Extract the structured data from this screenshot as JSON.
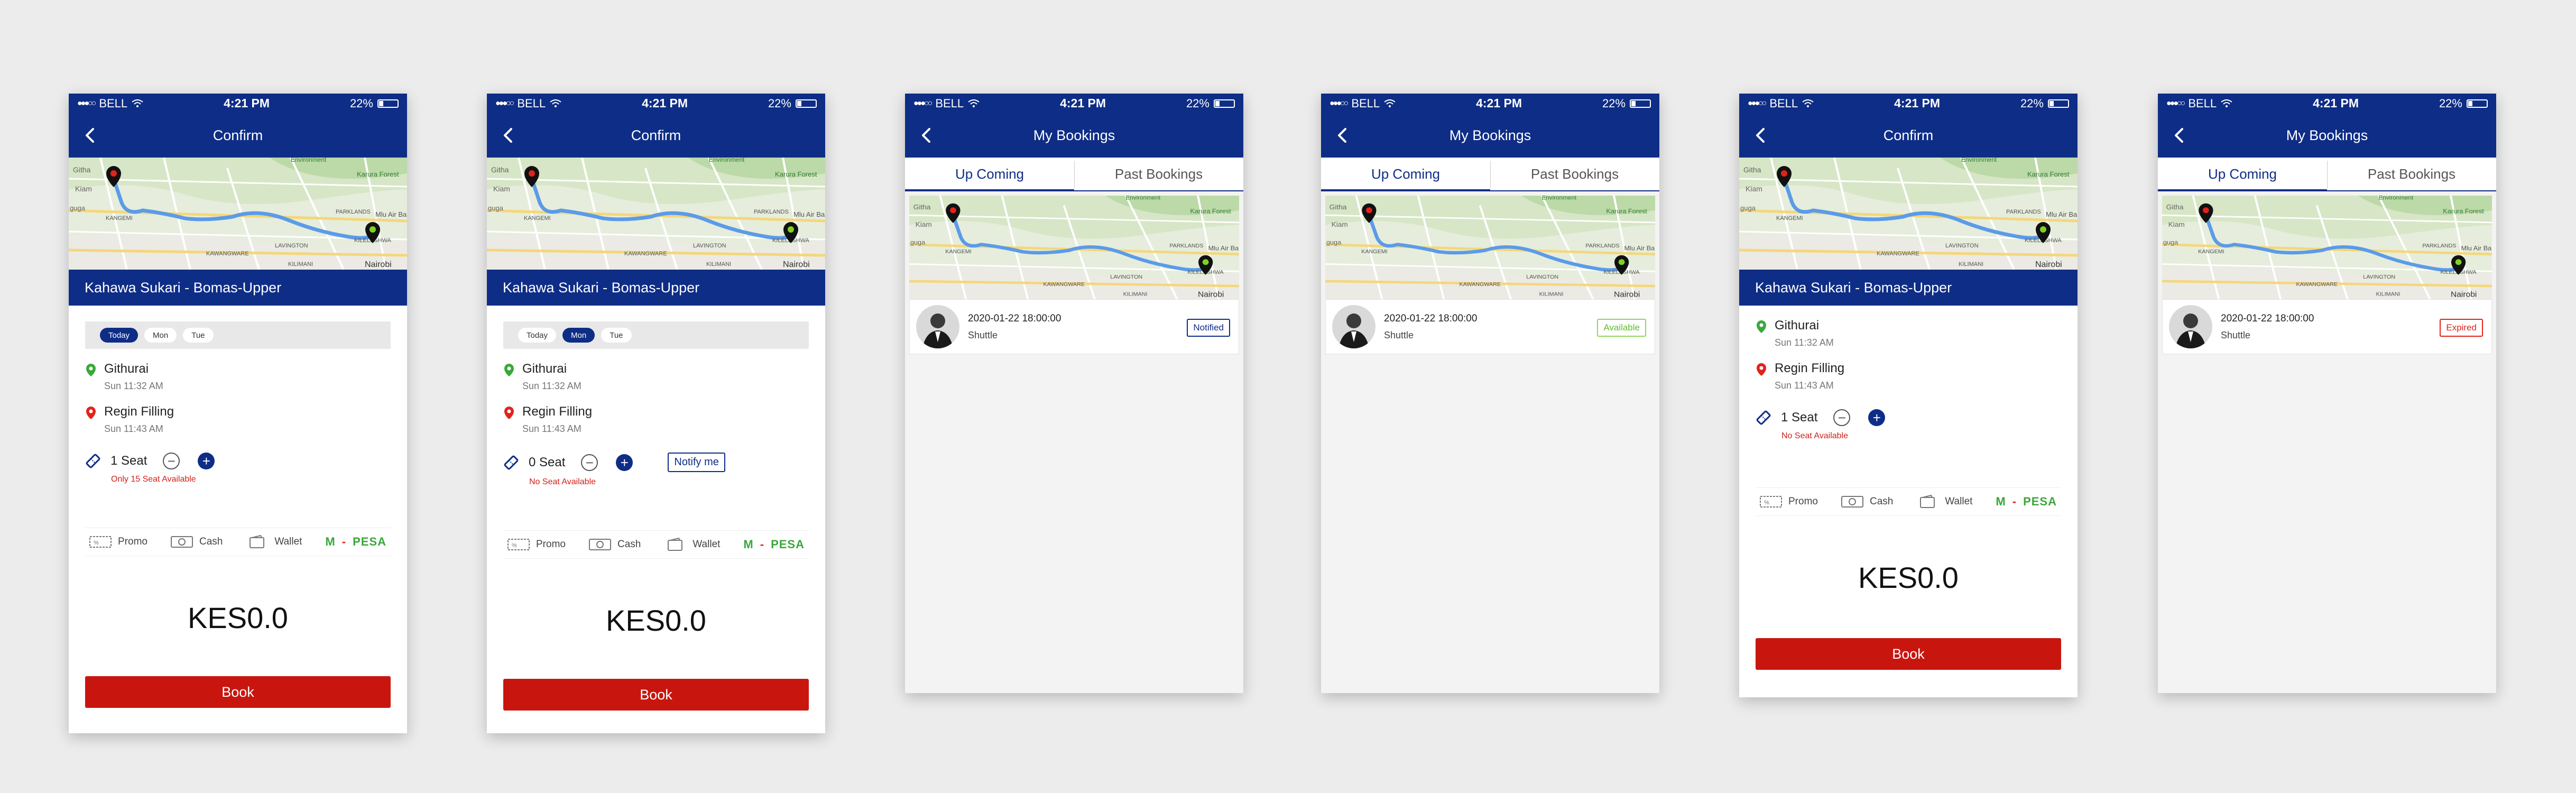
{
  "status_bar": {
    "carrier": "BELL",
    "time": "4:21 PM",
    "battery": "22%"
  },
  "colors": {
    "primary": "#0e2d86",
    "book": "#c8160f",
    "notified": "#0e2d86",
    "available": "#5cbf2a",
    "expired": "#e2231a"
  },
  "map_labels": {
    "l1": "Githa",
    "l2": "Kiam",
    "l3": "Environment",
    "l4": "Karura Forest",
    "l5": "Nairobi",
    "l6": "PARKLANDS",
    "l7": "Mlu Air Ba",
    "l8": "KANGEMI",
    "l9": "LAVINGTON",
    "l10": "KAWANGWARE",
    "l11": "KILIMANI",
    "l12": "KILELESHWA",
    "l13": "guga"
  },
  "screens": [
    {
      "title": "Confirm",
      "route": "Kahawa Sukari - Bomas-Upper",
      "days": [
        "Today",
        "Mon",
        "Tue"
      ],
      "from_name": "Githurai",
      "from_time": "Sun 11:32 AM",
      "to_name": "Regin Filling",
      "to_time": "Sun 11:43 AM",
      "seats": "1 Seat",
      "seat_note": "Only 15  Seat Available",
      "pay": {
        "promo": "Promo",
        "cash": "Cash",
        "wallet": "Wallet"
      },
      "price": "KES0.0",
      "book": "Book"
    },
    {
      "title": "Confirm",
      "route": "Kahawa Sukari - Bomas-Upper",
      "days": [
        "Today",
        "Mon",
        "Tue"
      ],
      "from_name": "Githurai",
      "from_time": "Sun 11:32 AM",
      "to_name": "Regin Filling",
      "to_time": "Sun 11:43 AM",
      "seats": "0 Seat",
      "notify": "Notify me",
      "seat_note": "No Seat Available",
      "pay": {
        "promo": "Promo",
        "cash": "Cash",
        "wallet": "Wallet"
      },
      "price": "KES0.0",
      "book": "Book"
    },
    {
      "title": "My Bookings",
      "tabs": [
        "Up Coming",
        "Past Bookings"
      ],
      "booking": {
        "date": "2020-01-22 18:00:00",
        "type": "Shuttle",
        "status": "Notified"
      }
    },
    {
      "title": "My Bookings",
      "tabs": [
        "Up Coming",
        "Past Bookings"
      ],
      "booking": {
        "date": "2020-01-22 18:00:00",
        "type": "Shuttle",
        "status": "Available"
      }
    },
    {
      "title": "Confirm",
      "route": "Kahawa Sukari - Bomas-Upper",
      "from_name": "Githurai",
      "from_time": "Sun 11:32 AM",
      "to_name": "Regin Filling",
      "to_time": "Sun 11:43 AM",
      "seats": "1 Seat",
      "seat_note": "No Seat Available",
      "pay": {
        "promo": "Promo",
        "cash": "Cash",
        "wallet": "Wallet"
      },
      "price": "KES0.0",
      "book": "Book"
    },
    {
      "title": "My Bookings",
      "tabs": [
        "Up Coming",
        "Past Bookings"
      ],
      "booking": {
        "date": "2020-01-22 18:00:00",
        "type": "Shuttle",
        "status": "Expired"
      }
    }
  ]
}
